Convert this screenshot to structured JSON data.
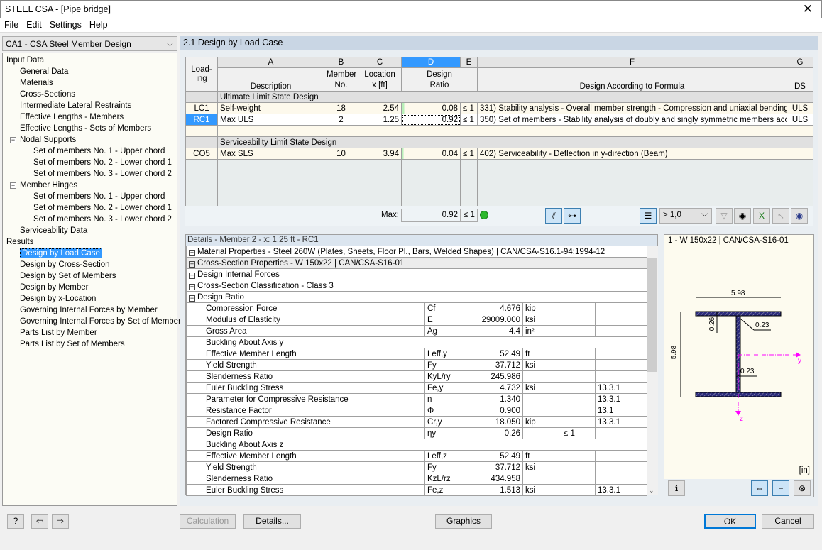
{
  "window": {
    "title": "STEEL CSA - [Pipe bridge]",
    "close": "✕"
  },
  "menu": [
    "File",
    "Edit",
    "Settings",
    "Help"
  ],
  "case_select": "CA1 - CSA Steel Member Design",
  "tree": [
    {
      "label": "Input Data",
      "level": 0
    },
    {
      "label": "General Data",
      "level": 1
    },
    {
      "label": "Materials",
      "level": 1
    },
    {
      "label": "Cross-Sections",
      "level": 1
    },
    {
      "label": "Intermediate Lateral Restraints",
      "level": 1
    },
    {
      "label": "Effective Lengths - Members",
      "level": 1
    },
    {
      "label": "Effective Lengths - Sets of Members",
      "level": 1
    },
    {
      "label": "Nodal Supports",
      "level": 1,
      "expanded": true
    },
    {
      "label": "Set of members No. 1 - Upper chord",
      "level": 2
    },
    {
      "label": "Set of members No. 2 - Lower chord 1",
      "level": 2
    },
    {
      "label": "Set of members No. 3 - Lower chord 2",
      "level": 2
    },
    {
      "label": "Member Hinges",
      "level": 1,
      "expanded": true
    },
    {
      "label": "Set of members No. 1 - Upper chord",
      "level": 2
    },
    {
      "label": "Set of members No. 2 - Lower chord 1",
      "level": 2
    },
    {
      "label": "Set of members No. 3 - Lower chord 2",
      "level": 2
    },
    {
      "label": "Serviceability Data",
      "level": 1
    },
    {
      "label": "Results",
      "level": 0
    },
    {
      "label": "Design by Load Case",
      "level": 1,
      "selected": true
    },
    {
      "label": "Design by Cross-Section",
      "level": 1
    },
    {
      "label": "Design by Set of Members",
      "level": 1
    },
    {
      "label": "Design by Member",
      "level": 1
    },
    {
      "label": "Design by x-Location",
      "level": 1
    },
    {
      "label": "Governing Internal Forces by Member",
      "level": 1
    },
    {
      "label": "Governing Internal Forces by Set of Members",
      "level": 1
    },
    {
      "label": "Parts List by Member",
      "level": 1
    },
    {
      "label": "Parts List by Set of Members",
      "level": 1
    }
  ],
  "header": "2.1 Design by Load Case",
  "table": {
    "letters": [
      "A",
      "B",
      "C",
      "D",
      "E",
      "F",
      "G"
    ],
    "headers": {
      "loading": "Load-\ning",
      "a": "Description",
      "b": "Member\nNo.",
      "c": "Location\nx [ft]",
      "d": "Design\nRatio",
      "f": "Design According to Formula",
      "g": "DS"
    },
    "groups": [
      "Ultimate Limit State Design",
      "Serviceability Limit State Design"
    ],
    "rows": [
      {
        "id": "LC1",
        "desc": "Self-weight",
        "member": "18",
        "x": "2.54",
        "ratio": "0.08",
        "le": "≤ 1",
        "formula": "331) Stability analysis - Overall member strength - Compression and uniaxial bending about y",
        "ds": "ULS"
      },
      {
        "id": "RC1",
        "desc": "Max ULS",
        "member": "2",
        "x": "1.25",
        "ratio": "0.92",
        "le": "≤ 1",
        "formula": "350) Set of members - Stability analysis of doubly and singly symmetric members acc. to 13.8",
        "ds": "ULS"
      },
      {
        "id": "CO5",
        "desc": "Max SLS",
        "member": "10",
        "x": "3.94",
        "ratio": "0.04",
        "le": "≤ 1",
        "formula": "402) Serviceability - Deflection in y-direction (Beam)",
        "ds": ""
      }
    ],
    "max_label": "Max:",
    "max_value": "0.92",
    "max_le": "≤ 1",
    "filter_value": "> 1,0"
  },
  "details": {
    "title": "Details - Member 2 - x: 1.25 ft - RC1",
    "sections": [
      "Material Properties - Steel 260W (Plates, Sheets, Floor Pl., Bars, Welded Shapes) | CAN/CSA-S16.1-94:1994-12",
      "Cross-Section Properties  -  W 150x22 | CAN/CSA-S16-01",
      "Design Internal Forces",
      "Cross-Section Classification - Class 3",
      "Design Ratio"
    ],
    "rows": [
      {
        "name": "Compression Force",
        "sym": "Cf",
        "val": "4.676",
        "unit": "kip",
        "le": "",
        "ref": ""
      },
      {
        "name": "Modulus of Elasticity",
        "sym": "E",
        "val": "29009.000",
        "unit": "ksi",
        "le": "",
        "ref": ""
      },
      {
        "name": "Gross Area",
        "sym": "Ag",
        "val": "4.4",
        "unit": "in²",
        "le": "",
        "ref": ""
      },
      {
        "name": "Buckling About Axis y",
        "sub": true
      },
      {
        "name": "Effective Member Length",
        "sym": "Leff,y",
        "val": "52.49",
        "unit": "ft",
        "le": "",
        "ref": ""
      },
      {
        "name": "Yield Strength",
        "sym": "Fy",
        "val": "37.712",
        "unit": "ksi",
        "le": "",
        "ref": ""
      },
      {
        "name": "Slenderness Ratio",
        "sym": "KyL/ry",
        "val": "245.986",
        "unit": "",
        "le": "",
        "ref": ""
      },
      {
        "name": "Euler Buckling Stress",
        "sym": "Fe,y",
        "val": "4.732",
        "unit": "ksi",
        "le": "",
        "ref": "13.3.1"
      },
      {
        "name": "Parameter for Compressive Resistance",
        "sym": "n",
        "val": "1.340",
        "unit": "",
        "le": "",
        "ref": "13.3.1"
      },
      {
        "name": "Resistance Factor",
        "sym": "Φ",
        "val": "0.900",
        "unit": "",
        "le": "",
        "ref": "13.1"
      },
      {
        "name": "Factored Compressive Resistance",
        "sym": "Cr,y",
        "val": "18.050",
        "unit": "kip",
        "le": "",
        "ref": "13.3.1"
      },
      {
        "name": "Design Ratio",
        "sym": "ηy",
        "val": "0.26",
        "unit": "",
        "le": "≤ 1",
        "ref": ""
      },
      {
        "name": "Buckling About Axis z",
        "sub": true
      },
      {
        "name": "Effective Member Length",
        "sym": "Leff,z",
        "val": "52.49",
        "unit": "ft",
        "le": "",
        "ref": ""
      },
      {
        "name": "Yield Strength",
        "sym": "Fy",
        "val": "37.712",
        "unit": "ksi",
        "le": "",
        "ref": ""
      },
      {
        "name": "Slenderness Ratio",
        "sym": "KzL/rz",
        "val": "434.958",
        "unit": "",
        "le": "",
        "ref": ""
      },
      {
        "name": "Euler Buckling Stress",
        "sym": "Fe,z",
        "val": "1.513",
        "unit": "ksi",
        "le": "",
        "ref": "13.3.1"
      }
    ]
  },
  "graphic": {
    "title": "1 - W 150x22 | CAN/CSA-S16-01",
    "width": "5.98",
    "height": "5.98",
    "flange": "0.26",
    "radius": "0.23",
    "web": "0.23",
    "axis_y": "y",
    "axis_z": "z",
    "units": "[in]"
  },
  "buttons": {
    "calculation": "Calculation",
    "details": "Details...",
    "graphics": "Graphics",
    "ok": "OK",
    "cancel": "Cancel"
  },
  "colors": {
    "selection": "#3399ff",
    "section_fill": "#2a2a7a",
    "axis": "#ff00ff",
    "ok_indicator": "#2db82d"
  }
}
